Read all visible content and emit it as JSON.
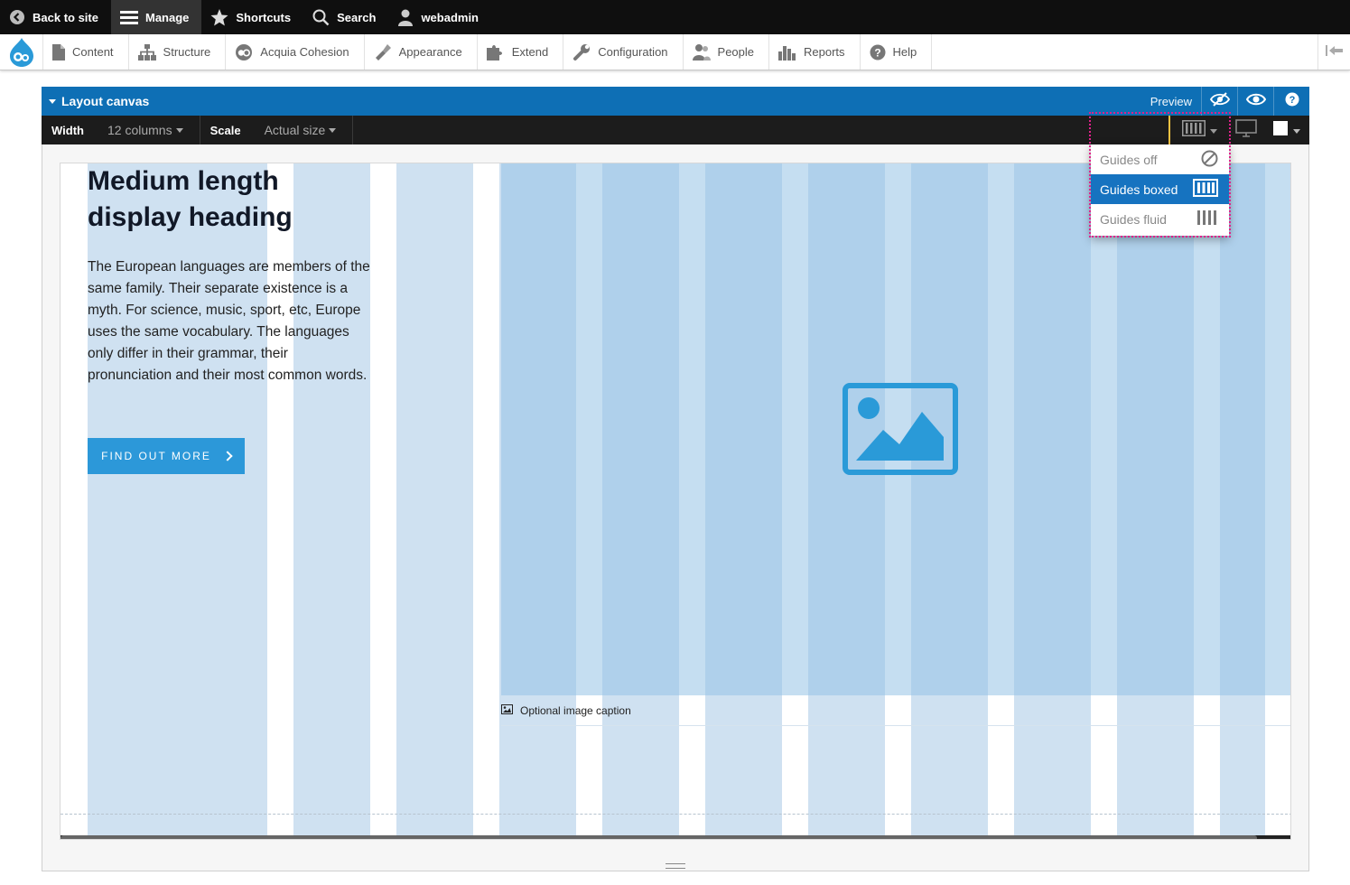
{
  "topbar": {
    "back_label": "Back to site",
    "manage_label": "Manage",
    "shortcuts_label": "Shortcuts",
    "search_label": "Search",
    "user_label": "webadmin"
  },
  "tray": {
    "items": [
      {
        "label": "Content",
        "icon": "document-icon"
      },
      {
        "label": "Structure",
        "icon": "hierarchy-icon"
      },
      {
        "label": "Acquia Cohesion",
        "icon": "cohesion-icon"
      },
      {
        "label": "Appearance",
        "icon": "paintbrush-icon"
      },
      {
        "label": "Extend",
        "icon": "puzzle-icon"
      },
      {
        "label": "Configuration",
        "icon": "wrench-icon"
      },
      {
        "label": "People",
        "icon": "people-icon"
      },
      {
        "label": "Reports",
        "icon": "bar-chart-icon"
      },
      {
        "label": "Help",
        "icon": "help-icon"
      }
    ]
  },
  "canvas": {
    "title": "Layout canvas",
    "preview_label": "Preview",
    "width_label": "Width",
    "width_value": "12 columns",
    "scale_label": "Scale",
    "scale_value": "Actual size"
  },
  "guides_menu": {
    "options": [
      {
        "label": "Guides off",
        "icon": "no-entry-icon",
        "selected": false
      },
      {
        "label": "Guides boxed",
        "icon": "columns-boxed-icon",
        "selected": true
      },
      {
        "label": "Guides fluid",
        "icon": "columns-fluid-icon",
        "selected": false
      }
    ]
  },
  "content": {
    "heading_line1": "Medium length",
    "heading_line2": "display heading",
    "body": "The European languages are members of the same family. Their separate existence is a myth. For science, music, sport, etc, Europe uses the same vocabulary. The languages only differ in their grammar, their pronunciation and their most common words.",
    "cta_label": "FIND OUT MORE",
    "caption": "Optional image caption"
  },
  "colors": {
    "accent": "#0e6fb5",
    "cta": "#2c98d9",
    "highlight": "#e0208a",
    "active_guides": "#f5c242"
  }
}
